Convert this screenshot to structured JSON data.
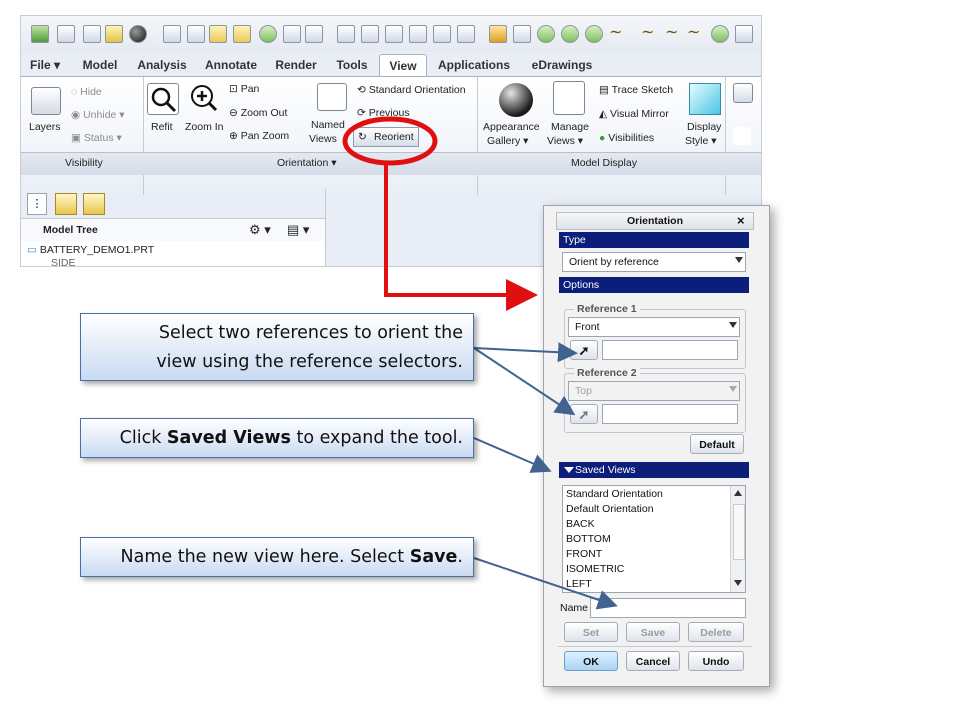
{
  "ribbon": {
    "tabs": [
      "File ▾",
      "Model",
      "Analysis",
      "Annotate",
      "Render",
      "Tools",
      "View",
      "Applications",
      "eDrawings"
    ],
    "active_tab": "View",
    "visibility": {
      "layers": "Layers",
      "hide": "Hide",
      "unhide": "Unhide",
      "status": "Status",
      "group_label": "Visibility"
    },
    "orientation": {
      "refit": "Refit",
      "zoom_in": "Zoom In",
      "pan": "Pan",
      "zoom_out": "Zoom Out",
      "pan_zoom": "Pan Zoom",
      "named_views_1": "Named",
      "named_views_2": "Views",
      "standard_orientation": "Standard Orientation",
      "previous": "Previous",
      "reorient": "Reorient",
      "group_label": "Orientation ▾"
    },
    "model_display": {
      "appearance_gallery_1": "Appearance",
      "appearance_gallery_2": "Gallery ▾",
      "manage_views_1": "Manage",
      "manage_views_2": "Views ▾",
      "trace_sketch": "Trace Sketch",
      "visual_mirror": "Visual Mirror",
      "visibilities": "Visibilities",
      "display_style_1": "Display",
      "display_style_2": "Style ▾",
      "group_label": "Model Display"
    }
  },
  "model_tree": {
    "title": "Model Tree",
    "root_item": "BATTERY_DEMO1.PRT",
    "partial_item": "SIDE"
  },
  "dialog": {
    "title": "Orientation",
    "close": "×",
    "type_header": "Type",
    "type_value": "Orient by reference",
    "options_header": "Options",
    "reference1_label": "Reference 1",
    "reference1_value": "Front",
    "reference2_label": "Reference 2",
    "reference2_value": "Top",
    "default_button": "Default",
    "saved_views_header": "Saved Views",
    "saved_views": [
      "Standard Orientation",
      "Default Orientation",
      "BACK",
      "BOTTOM",
      "FRONT",
      "ISOMETRIC",
      "LEFT"
    ],
    "name_label": "Name",
    "name_value": "",
    "set_button": "Set",
    "save_button": "Save",
    "delete_button": "Delete",
    "ok_button": "OK",
    "cancel_button": "Cancel",
    "undo_button": "Undo"
  },
  "callouts": {
    "c1_line1": "Select two references to orient the",
    "c1_line2": "view using the reference selectors.",
    "c2_pre": "Click ",
    "c2_bold": "Saved Views",
    "c2_post": " to expand the tool.",
    "c3_pre": "Name the new view here. Select ",
    "c3_bold": "Save",
    "c3_post": "."
  },
  "colors": {
    "highlight_red": "#e01010",
    "dialog_header_blue": "#0b1f7a",
    "callout_border": "#4a6fa5",
    "arrow_blue": "#41638f"
  }
}
